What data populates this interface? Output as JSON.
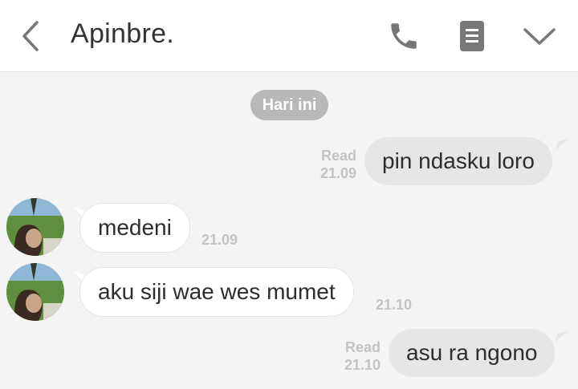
{
  "header": {
    "title": "Apinbre.",
    "icons": {
      "back": "chevron-left-icon",
      "call": "phone-icon",
      "menu": "note-icon",
      "more": "chevron-down-icon"
    }
  },
  "chat": {
    "date_label": "Hari ini",
    "messages": [
      {
        "direction": "out",
        "text": "pin ndasku loro",
        "status": "Read",
        "time": "21.09"
      },
      {
        "direction": "in",
        "text": "medeni",
        "time": "21.09"
      },
      {
        "direction": "in",
        "text": "aku siji wae wes mumet",
        "time": "21.10"
      },
      {
        "direction": "out",
        "text": "asu ra ngono",
        "status": "Read",
        "time": "21.10"
      }
    ]
  },
  "colors": {
    "header_bg": "#ffffff",
    "chat_bg": "#f4f4f4",
    "icon_gray": "#777777",
    "out_bubble": "#e6e6e6",
    "in_bubble": "#ffffff",
    "meta_text": "#c4c4c4",
    "date_pill": "#b8b8b8"
  }
}
